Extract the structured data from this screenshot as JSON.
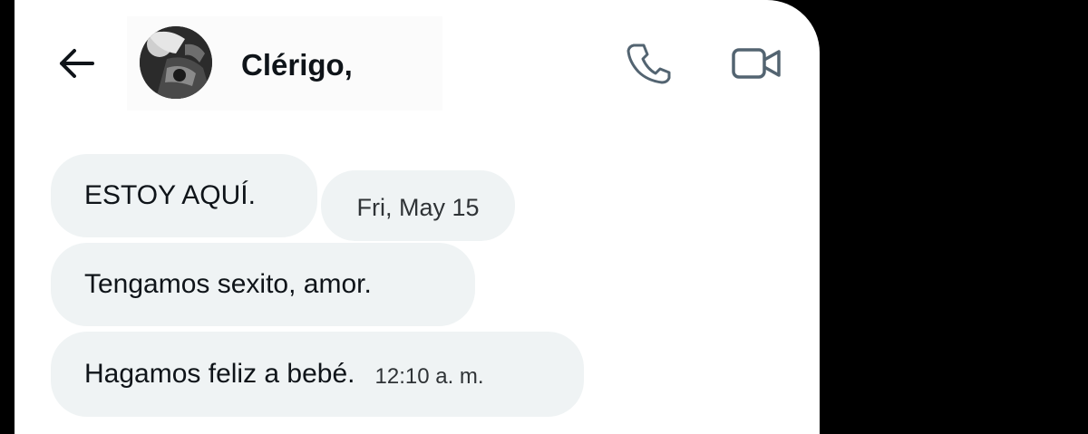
{
  "header": {
    "contact_name": "Clérigo,",
    "back_icon": "arrow-left-icon",
    "call_icon": "phone-icon",
    "video_icon": "video-camera-icon"
  },
  "messages": [
    {
      "text": "ESTOY AQUÍ."
    },
    {
      "text": "Tengamos sexito, amor."
    },
    {
      "text": "Hagamos feliz a bebé.",
      "time": "12:10 a. m."
    }
  ],
  "date_separator": "Fri, May 15",
  "colors": {
    "bubble_bg": "#eff3f4",
    "text": "#0f1419",
    "icon_gray": "#536471",
    "backdrop": "#000000"
  }
}
